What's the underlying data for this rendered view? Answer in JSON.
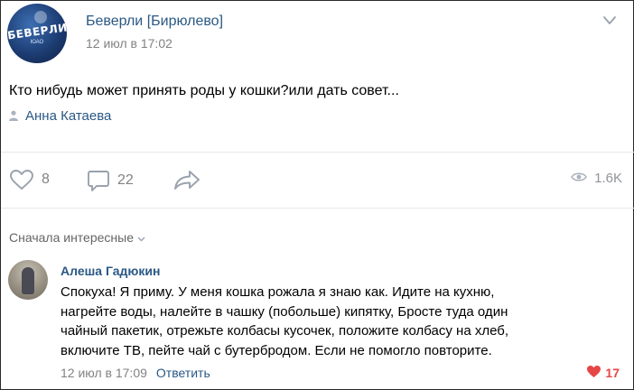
{
  "post": {
    "group_name": "Беверли [Бирюлево]",
    "date": "12 июл в 17:02",
    "avatar_logo_text": "БЕВЕРЛИ",
    "avatar_logo_sub": "ЮАО",
    "text": "Кто нибудь может принять роды у кошки?или дать совет...",
    "author": "Анна Катаева"
  },
  "actions": {
    "likes": "8",
    "comments": "22",
    "views": "1.6K"
  },
  "comments": {
    "sort_label": "Сначала интересные",
    "items": [
      {
        "name": "Алеша Гадюкин",
        "lines": [
          "Спокуха! Я приму. У меня кошка рожала я знаю как. Идите на кухню,",
          "нагрейте воды, налейте в чашку (побольше) кипятку, Бросте туда один",
          "чайный пакетик, отрежьте колбасы кусочек, положите колбасу на хлеб,",
          "включите ТВ, пейте чай с бутербродом. Если не помогло повторите."
        ],
        "date": "12 июл в 17:09",
        "reply_label": "Ответить",
        "likes": "17"
      }
    ]
  },
  "colors": {
    "link": "#2a5885",
    "meta": "#828282",
    "like_active": "#e64646"
  },
  "icons": [
    "more-icon",
    "person-icon",
    "heart-icon",
    "comment-icon",
    "share-icon",
    "eye-icon",
    "chevron-down-icon",
    "heart-filled-icon"
  ]
}
